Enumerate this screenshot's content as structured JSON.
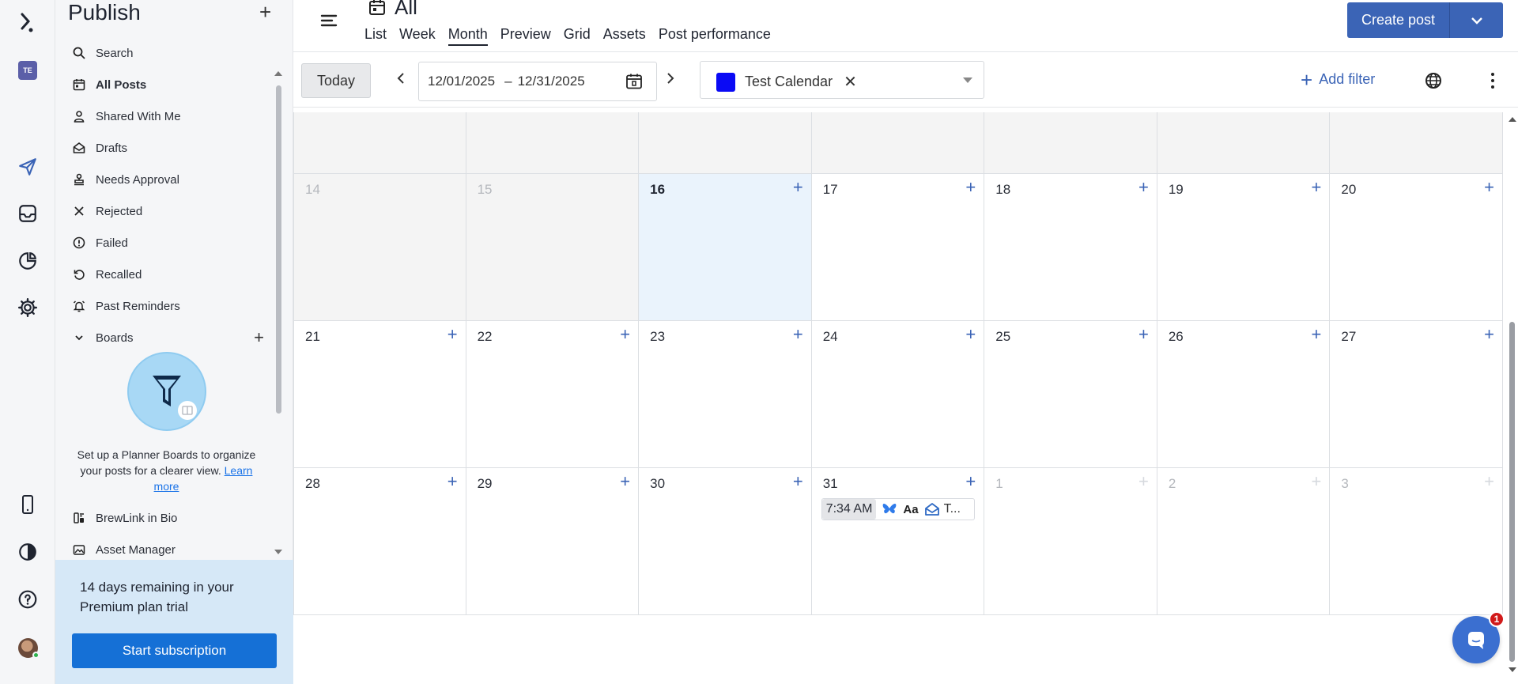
{
  "sidebar": {
    "title": "Publish",
    "items": [
      {
        "label": "Search"
      },
      {
        "label": "All Posts"
      },
      {
        "label": "Shared With Me"
      },
      {
        "label": "Drafts"
      },
      {
        "label": "Needs Approval"
      },
      {
        "label": "Rejected"
      },
      {
        "label": "Failed"
      },
      {
        "label": "Recalled"
      },
      {
        "label": "Past Reminders"
      }
    ],
    "boards_label": "Boards",
    "planner_text": "Set up a Planner Boards to organize your posts for a clearer view.",
    "learn_more": "Learn more",
    "bottom_items": [
      {
        "label": "BrewLink in Bio"
      },
      {
        "label": "Asset Manager"
      }
    ],
    "trial_text": "14 days remaining in your Premium plan trial",
    "trial_button": "Start subscription"
  },
  "rail": {
    "workspace_badge": "TE",
    "chat_badge": "1"
  },
  "header": {
    "title": "All",
    "tabs": [
      {
        "label": "List"
      },
      {
        "label": "Week"
      },
      {
        "label": "Month"
      },
      {
        "label": "Preview"
      },
      {
        "label": "Grid"
      },
      {
        "label": "Assets"
      },
      {
        "label": "Post performance"
      }
    ],
    "create_label": "Create post"
  },
  "toolbar": {
    "today_label": "Today",
    "date_start": "12/01/2025",
    "date_sep": "–",
    "date_end": "12/31/2025",
    "calendar_name": "Test Calendar",
    "calendar_color": "#0a0af5",
    "add_filter_label": "Add filter"
  },
  "calendar": {
    "weeks": [
      [
        "14",
        "15",
        "16",
        "17",
        "18",
        "19",
        "20"
      ],
      [
        "21",
        "22",
        "23",
        "24",
        "25",
        "26",
        "27"
      ],
      [
        "28",
        "29",
        "30",
        "31",
        "1",
        "2",
        "3"
      ]
    ],
    "event": {
      "time": "7:34 AM",
      "format_label": "Aa",
      "title": "T..."
    }
  }
}
